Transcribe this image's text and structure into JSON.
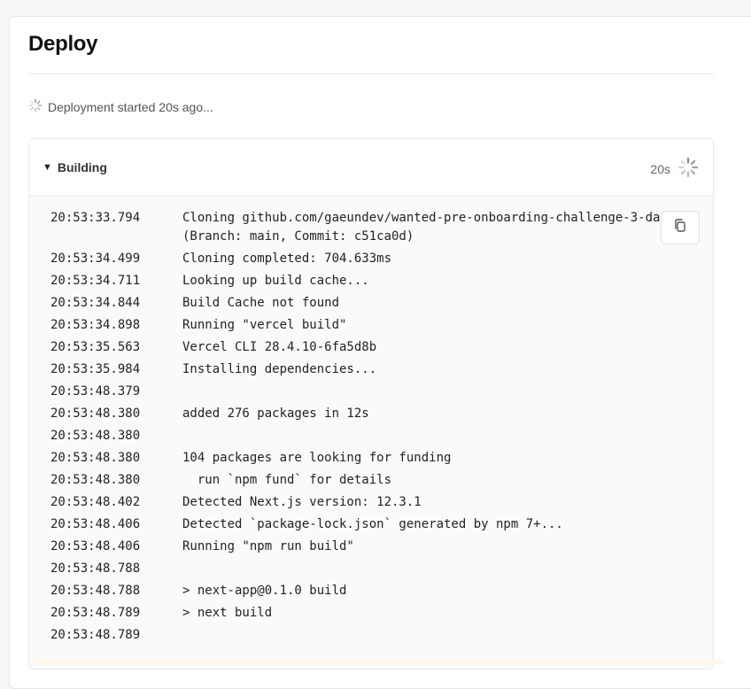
{
  "page": {
    "title": "Deploy",
    "status_text": "Deployment started 20s ago..."
  },
  "build": {
    "label": "Building",
    "elapsed": "20s",
    "icons": {
      "caret": "caret-down-icon",
      "spinner": "spinner-icon",
      "copy": "copy-icon"
    },
    "logs": [
      {
        "ts": "20:53:33.794",
        "msg": "Cloning github.com/gaeundev/wanted-pre-onboarding-challenge-3-day2\n(Branch: main, Commit: c51ca0d)"
      },
      {
        "ts": "20:53:34.499",
        "msg": "Cloning completed: 704.633ms"
      },
      {
        "ts": "20:53:34.711",
        "msg": "Looking up build cache..."
      },
      {
        "ts": "20:53:34.844",
        "msg": "Build Cache not found"
      },
      {
        "ts": "20:53:34.898",
        "msg": "Running \"vercel build\""
      },
      {
        "ts": "20:53:35.563",
        "msg": "Vercel CLI 28.4.10-6fa5d8b"
      },
      {
        "ts": "20:53:35.984",
        "msg": "Installing dependencies..."
      },
      {
        "ts": "20:53:48.379",
        "msg": ""
      },
      {
        "ts": "20:53:48.380",
        "msg": "added 276 packages in 12s"
      },
      {
        "ts": "20:53:48.380",
        "msg": ""
      },
      {
        "ts": "20:53:48.380",
        "msg": "104 packages are looking for funding"
      },
      {
        "ts": "20:53:48.380",
        "msg": "  run `npm fund` for details"
      },
      {
        "ts": "20:53:48.402",
        "msg": "Detected Next.js version: 12.3.1"
      },
      {
        "ts": "20:53:48.406",
        "msg": "Detected `package-lock.json` generated by npm 7+..."
      },
      {
        "ts": "20:53:48.406",
        "msg": "Running \"npm run build\""
      },
      {
        "ts": "20:53:48.788",
        "msg": ""
      },
      {
        "ts": "20:53:48.788",
        "msg": "> next-app@0.1.0 build"
      },
      {
        "ts": "20:53:48.789",
        "msg": "> next build"
      },
      {
        "ts": "20:53:48.789",
        "msg": ""
      }
    ]
  }
}
